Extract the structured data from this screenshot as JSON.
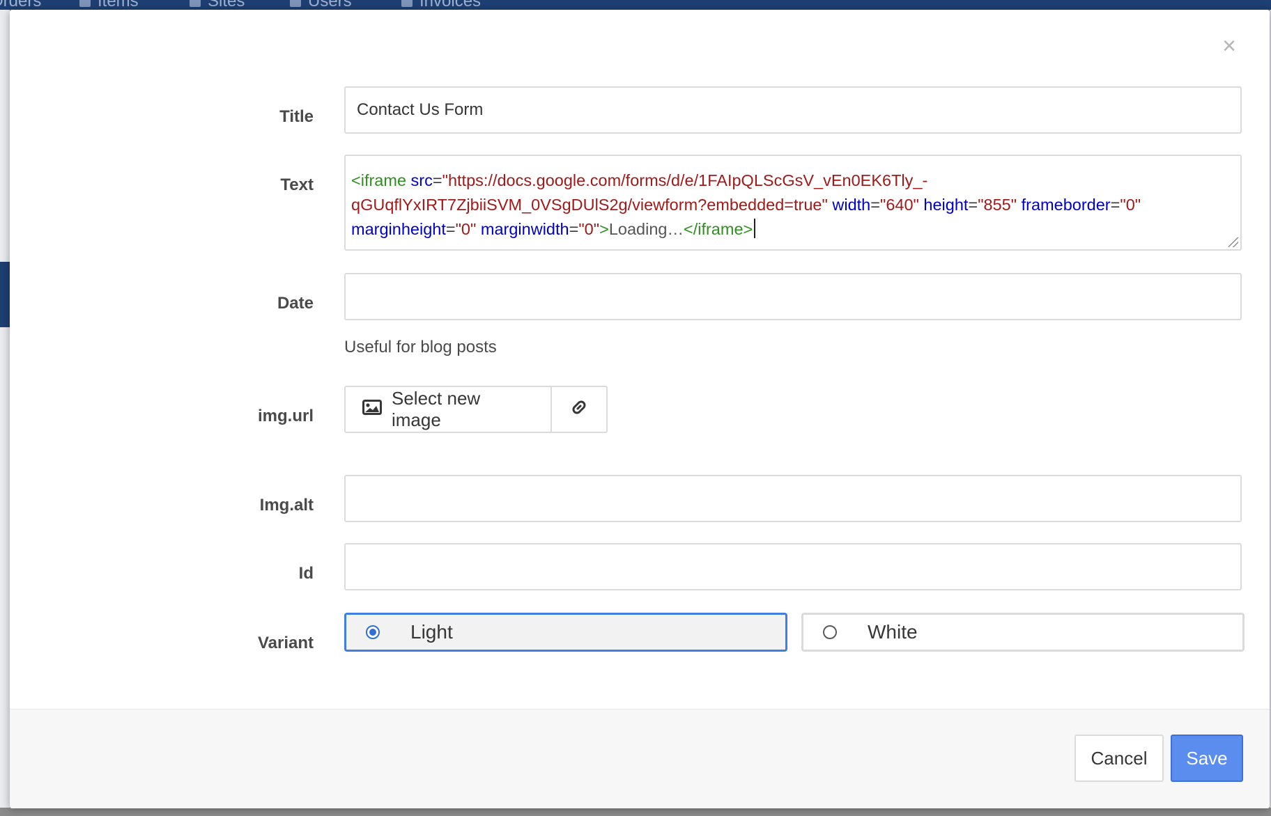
{
  "background": {
    "nav_items": [
      {
        "label": "Orders"
      },
      {
        "label": "Items"
      },
      {
        "label": "Sites"
      },
      {
        "label": "Users"
      },
      {
        "label": "Invoices"
      }
    ]
  },
  "modal": {
    "close_label": "×",
    "fields": {
      "title": {
        "label": "Title",
        "value": "Contact Us Form"
      },
      "text": {
        "label": "Text",
        "value": "<iframe src=\"https://docs.google.com/forms/d/e/1FAIpQLScGsV_vEn0EK6Tly_-qGUqflYxIRT7ZjbiiSVM_0VSgDUlS2g/viewform?embedded=true\" width=\"640\" height=\"855\" frameborder=\"0\" marginheight=\"0\" marginwidth=\"0\">Loading…</iframe>",
        "tokens": {
          "open_tag": "<iframe",
          "src_attr": "src",
          "src_val_1": "\"https://docs.google.com/forms/d/e/1FAIpQLScGsV_vEn0EK6Tly_-",
          "src_val_2": "qGUqflYxIRT7ZjbiiSVM_0VSgDUlS2g/viewform?embedded=true\"",
          "width_attr": "width",
          "width_val": "\"640\"",
          "height_attr": "height",
          "height_val": "\"855\"",
          "frameborder_attr": "frameborder",
          "frameborder_val": "\"0\"",
          "marginheight_attr": "marginheight",
          "marginheight_val": "\"0\"",
          "marginwidth_attr": "marginwidth",
          "marginwidth_val": "\"0\"",
          "gt": ">",
          "inner": "Loading…",
          "close_tag": "</iframe>"
        }
      },
      "date": {
        "label": "Date",
        "value": "",
        "help": "Useful for blog posts"
      },
      "img_url": {
        "label": "img.url",
        "select_button": "Select new image"
      },
      "img_alt": {
        "label": "Img.alt",
        "value": ""
      },
      "id": {
        "label": "Id",
        "value": ""
      },
      "variant": {
        "label": "Variant",
        "options": [
          {
            "label": "Light",
            "selected": true
          },
          {
            "label": "White",
            "selected": false
          }
        ]
      }
    },
    "footer": {
      "cancel": "Cancel",
      "save": "Save"
    }
  },
  "colors": {
    "accent": "#3f7fe0",
    "save_button": "#5b8def",
    "nav_bg": "#1e3f73"
  },
  "icons": {
    "image": "image-icon",
    "link": "link-icon",
    "close": "close-icon"
  }
}
